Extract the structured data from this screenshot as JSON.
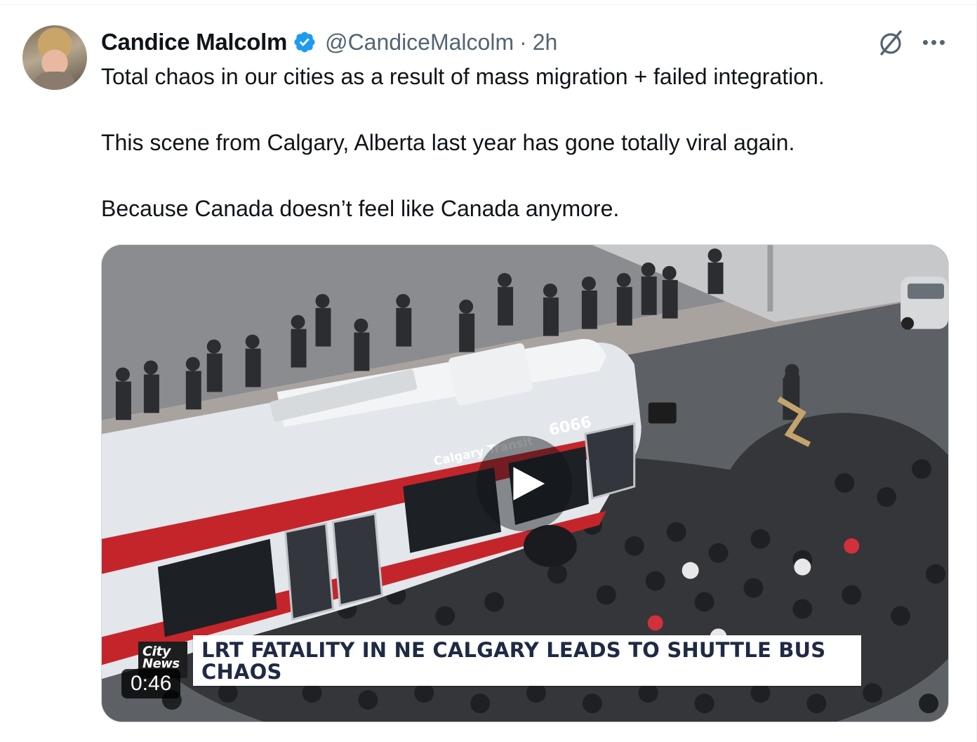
{
  "post": {
    "author_name": "Candice Malcolm",
    "verified": true,
    "handle": "@CandiceMalcolm",
    "separator": "·",
    "time": "2h",
    "paragraphs": [
      "Total chaos in our cities as a result of mass migration + failed integration.",
      "This scene from Calgary, Alberta last year has gone totally viral again.",
      "Because Canada doesn’t feel like Canada anymore."
    ]
  },
  "icons": {
    "verified": "verified-badge-icon",
    "grok": "grok-icon",
    "more": "more-icon",
    "play": "play-icon"
  },
  "video": {
    "duration": "0:46",
    "banner_text": "LRT FATALITY IN NE CALGARY LEADS TO SHUTTLE BUS CHAOS",
    "logo_line1": "City",
    "logo_line2": "News",
    "bus_fleet_number": "6066",
    "bus_brand": "Calgary Transit"
  },
  "colors": {
    "text_primary": "#0f1419",
    "text_secondary": "#536471",
    "verified_blue": "#1d9bf0",
    "bus_red": "#c4252b",
    "banner_text": "#1f2a44"
  }
}
